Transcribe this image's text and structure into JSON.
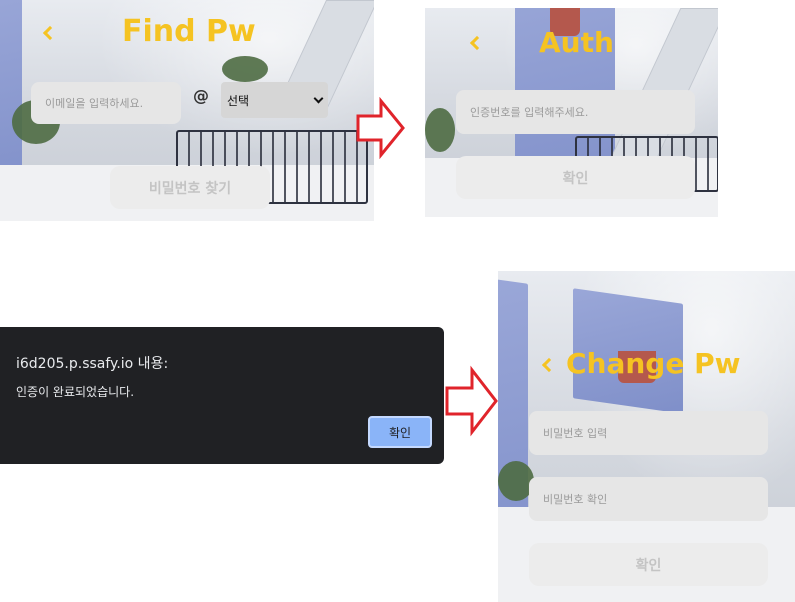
{
  "find_pw": {
    "title": "Find Pw",
    "email_placeholder": "이메일을 입력하세요.",
    "at_symbol": "@",
    "domain_select": "선택",
    "submit": "비밀번호 찾기"
  },
  "auth": {
    "title": "Auth",
    "code_placeholder": "인증번호를 입력해주세요.",
    "confirm": "확인"
  },
  "alert": {
    "title": "i6d205.p.ssafy.io 내용:",
    "message": "인증이 완료되었습니다.",
    "ok": "확인"
  },
  "change_pw": {
    "title": "Change Pw",
    "new_pw_placeholder": "비밀번호 입력",
    "confirm_pw_placeholder": "비밀번호 확인",
    "confirm": "확인"
  },
  "colors": {
    "accent": "#f5c322",
    "arrow": "#e0242b",
    "dialog_bg": "#202124",
    "dialog_button": "#8ab4f8"
  },
  "icons": [
    "back-chevron-icon",
    "select-chevron-icon",
    "flow-arrow-icon"
  ]
}
